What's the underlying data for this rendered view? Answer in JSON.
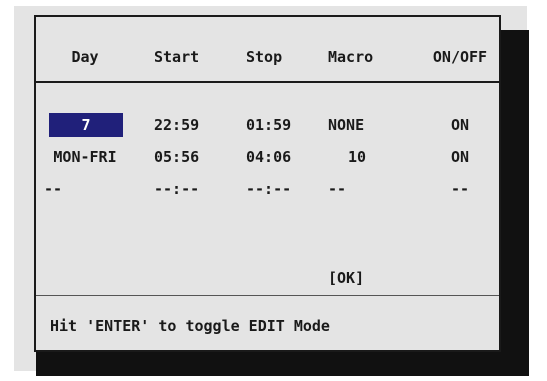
{
  "schedule": {
    "headers": {
      "day": "Day",
      "start": "Start",
      "stop": "Stop",
      "macro": "Macro",
      "onoff": "ON/OFF"
    },
    "rows": [
      {
        "day": "7",
        "start": "22:59",
        "stop": "01:59",
        "macro": "NONE",
        "onoff": "ON"
      },
      {
        "day": "MON-FRI",
        "start": "05:56",
        "stop": "04:06",
        "macro": "10",
        "onoff": "ON"
      },
      {
        "day": "--",
        "start": "--:--",
        "stop": "--:--",
        "macro": "--",
        "onoff": "--"
      }
    ],
    "ok_label": "[OK]",
    "hint": "Hit 'ENTER' to toggle EDIT Mode",
    "selected_cell_color": "#20207a"
  }
}
